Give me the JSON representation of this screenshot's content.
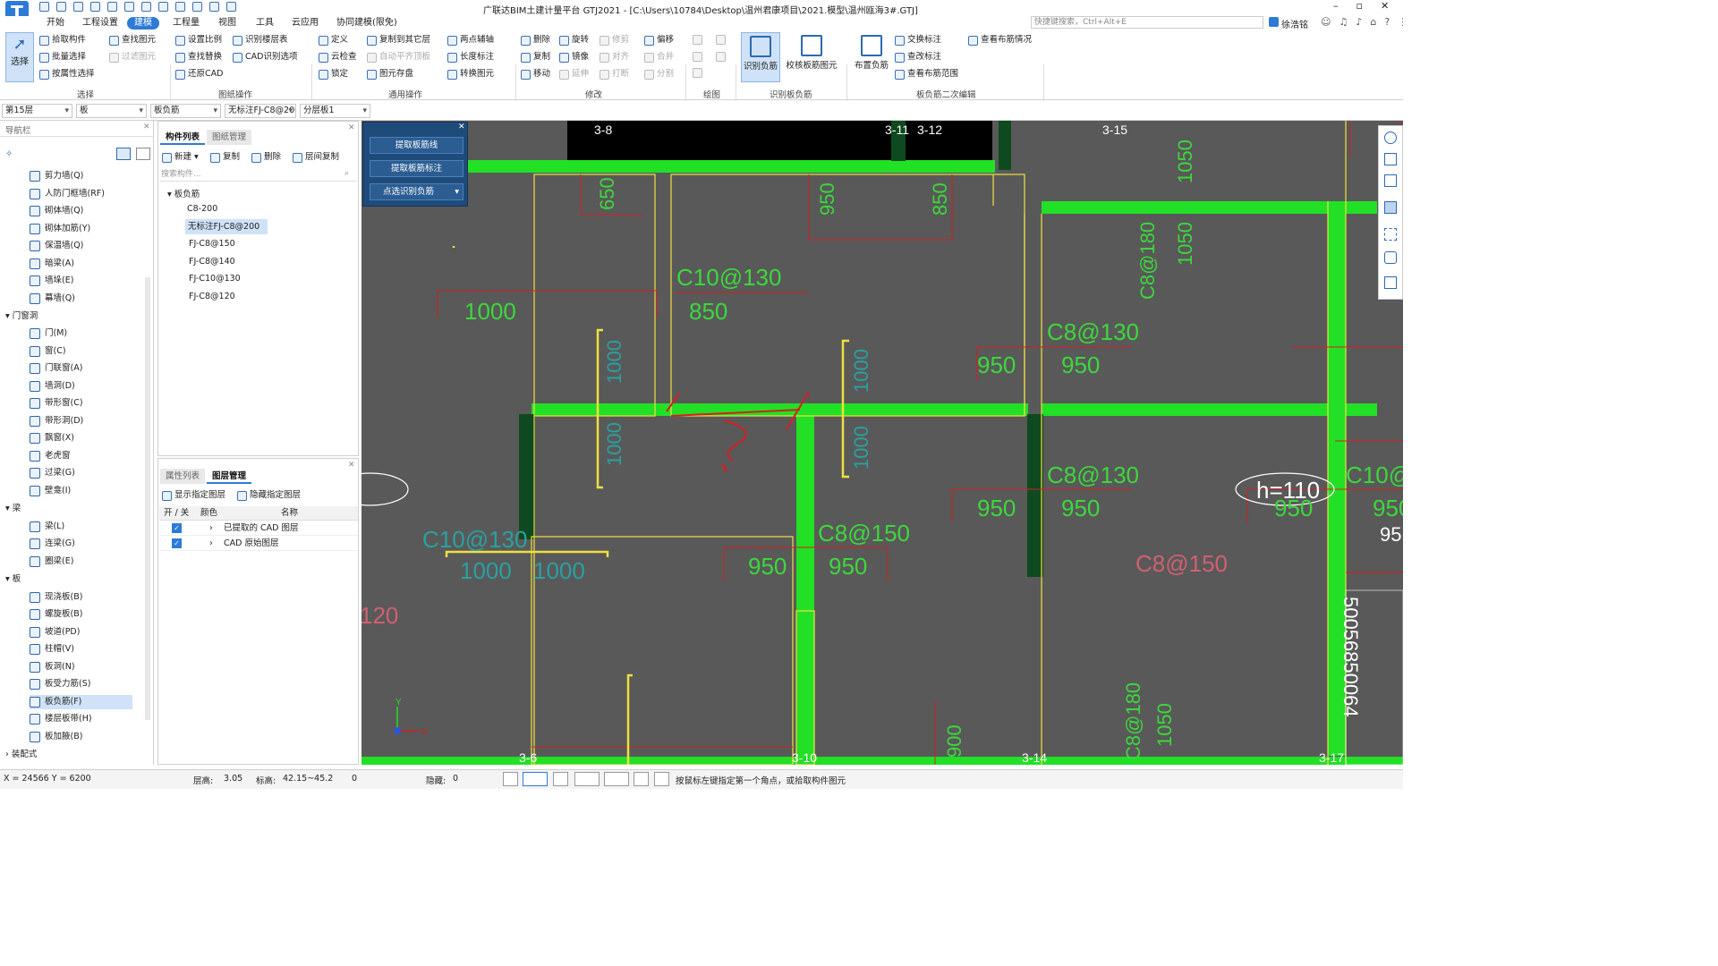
{
  "app": {
    "title": "广联达BIM土建计量平台 GTJ2021 - [C:\\Users\\10784\\Desktop\\温州君康项目\\2021.模型\\温州瓯海3#.GTJ]",
    "search_placeholder": "快捷键搜索，Ctrl+Alt+E",
    "user": "徐浩铭",
    "logo": "T"
  },
  "menu": [
    "开始",
    "工程设置",
    "建模",
    "工程量",
    "视图",
    "工具",
    "云应用",
    "协同建模(限免)"
  ],
  "ribbon": {
    "select_big": "选择",
    "select_group": [
      "拾取构件",
      "批量选择",
      "按属性选择",
      "查找图元",
      "过滤图元"
    ],
    "select_label": "选择",
    "drawing_group": [
      "设置比例",
      "识别楼层表",
      "查找替换",
      "CAD识别选项",
      "还原CAD"
    ],
    "drawing_label": "图纸操作",
    "general_group": [
      "定义",
      "复制到其它层",
      "两点辅轴",
      "云检查",
      "自动平齐顶板",
      "长度标注",
      "锁定",
      "图元存盘",
      "转换图元"
    ],
    "general_label": "通用操作",
    "modify_group": [
      "删除",
      "旋转",
      "修剪",
      "偏移",
      "复制",
      "镜像",
      "对齐",
      "合并",
      "移动",
      "延伸",
      "打断",
      "分割"
    ],
    "modify_label": "修改",
    "draw_label": "绘图",
    "recog_group": [
      "识别负筋",
      "校核板筋图元"
    ],
    "recog_label": "识别板负筋",
    "edit_group": [
      "布置负筋",
      "交换标注",
      "查改标注",
      "查看布筋范围",
      "查看布筋情况"
    ],
    "edit_label": "板负筋二次编辑"
  },
  "selectors": [
    "第15层",
    "板",
    "板负筋",
    "无标注FJ-C8@200",
    "分层板1"
  ],
  "nav": {
    "title": "导航栏",
    "items": [
      {
        "label": "剪力墙(Q)"
      },
      {
        "label": "人防门框墙(RF)"
      },
      {
        "label": "砌体墙(Q)"
      },
      {
        "label": "砌体加筋(Y)"
      },
      {
        "label": "保温墙(Q)"
      },
      {
        "label": "暗梁(A)"
      },
      {
        "label": "墙垛(E)"
      },
      {
        "label": "幕墙(Q)"
      }
    ],
    "group_door": "门窗洞",
    "door_items": [
      {
        "label": "门(M)"
      },
      {
        "label": "窗(C)"
      },
      {
        "label": "门联窗(A)"
      },
      {
        "label": "墙洞(D)"
      },
      {
        "label": "带形窗(C)"
      },
      {
        "label": "带形洞(D)"
      },
      {
        "label": "飘窗(X)"
      },
      {
        "label": "老虎窗"
      },
      {
        "label": "过梁(G)"
      },
      {
        "label": "壁龛(I)"
      }
    ],
    "group_beam": "梁",
    "beam_items": [
      {
        "label": "梁(L)"
      },
      {
        "label": "连梁(G)"
      },
      {
        "label": "圈梁(E)"
      }
    ],
    "group_slab": "板",
    "slab_items": [
      {
        "label": "现浇板(B)"
      },
      {
        "label": "螺旋板(B)"
      },
      {
        "label": "坡道(PD)"
      },
      {
        "label": "柱帽(V)"
      },
      {
        "label": "板洞(N)"
      },
      {
        "label": "板受力筋(S)"
      },
      {
        "label": "板负筋(F)"
      },
      {
        "label": "楼层板带(H)"
      },
      {
        "label": "板加腋(B)"
      }
    ],
    "group_assembly": "装配式"
  },
  "comp": {
    "tabs": [
      "构件列表",
      "图纸管理"
    ],
    "toolbar": [
      "新建",
      "复制",
      "删除",
      "层间复制"
    ],
    "search_placeholder": "搜索构件...",
    "tree_root": "板负筋",
    "items": [
      "C8-200",
      "无标注FJ-C8@200",
      "FJ-C8@150",
      "FJ-C8@140",
      "FJ-C10@130",
      "FJ-C8@120"
    ]
  },
  "layer": {
    "tabs": [
      "属性列表",
      "图层管理"
    ],
    "toolbar": [
      "显示指定图层",
      "隐藏指定图层"
    ],
    "headers": [
      "开 / 关",
      "颜色",
      "名称"
    ],
    "rows": [
      "已提取的 CAD 图层",
      "CAD 原始图层"
    ]
  },
  "float_panel": [
    "提取板筋线",
    "提取板筋标注",
    "点选识别负筋"
  ],
  "canvas_labels": {
    "axes_top": [
      "3-8",
      "3-11",
      "3-12",
      "3-15"
    ],
    "axes_bottom": [
      "3-6",
      "3-10",
      "3-14",
      "3-17"
    ],
    "annotations": [
      "650",
      "950",
      "850",
      "1050",
      "C8@180",
      "1050",
      "C10@130",
      "850",
      "1000",
      "C8@130",
      "950",
      "950",
      "950",
      "950",
      "C8@130",
      "950",
      "950",
      "h=110",
      "C10@13",
      "95",
      "C8@150",
      "950",
      "950",
      "C8@150",
      "1000",
      "1000",
      "C10@130",
      "120",
      "900",
      "C8@180",
      "1050",
      "1000",
      "1000",
      "1000",
      "1000",
      "50056850064"
    ]
  },
  "status": {
    "coords": "X = 24566 Y = 6200",
    "floor_h_label": "层高:",
    "floor_h": "3.05",
    "elev_label": "标高:",
    "elev": "42.15~45.2",
    "zero": "0",
    "hidden_label": "隐藏:",
    "hidden": "0",
    "hint": "按鼠标左键指定第一个角点，或拾取构件图元"
  },
  "colors": {
    "accent": "#2d7bd6",
    "canvas": "#595959",
    "beam_green": "#22e026",
    "cad_red": "#d42020",
    "cad_yellow": "#f0e040",
    "text_green": "#3cd83c"
  }
}
